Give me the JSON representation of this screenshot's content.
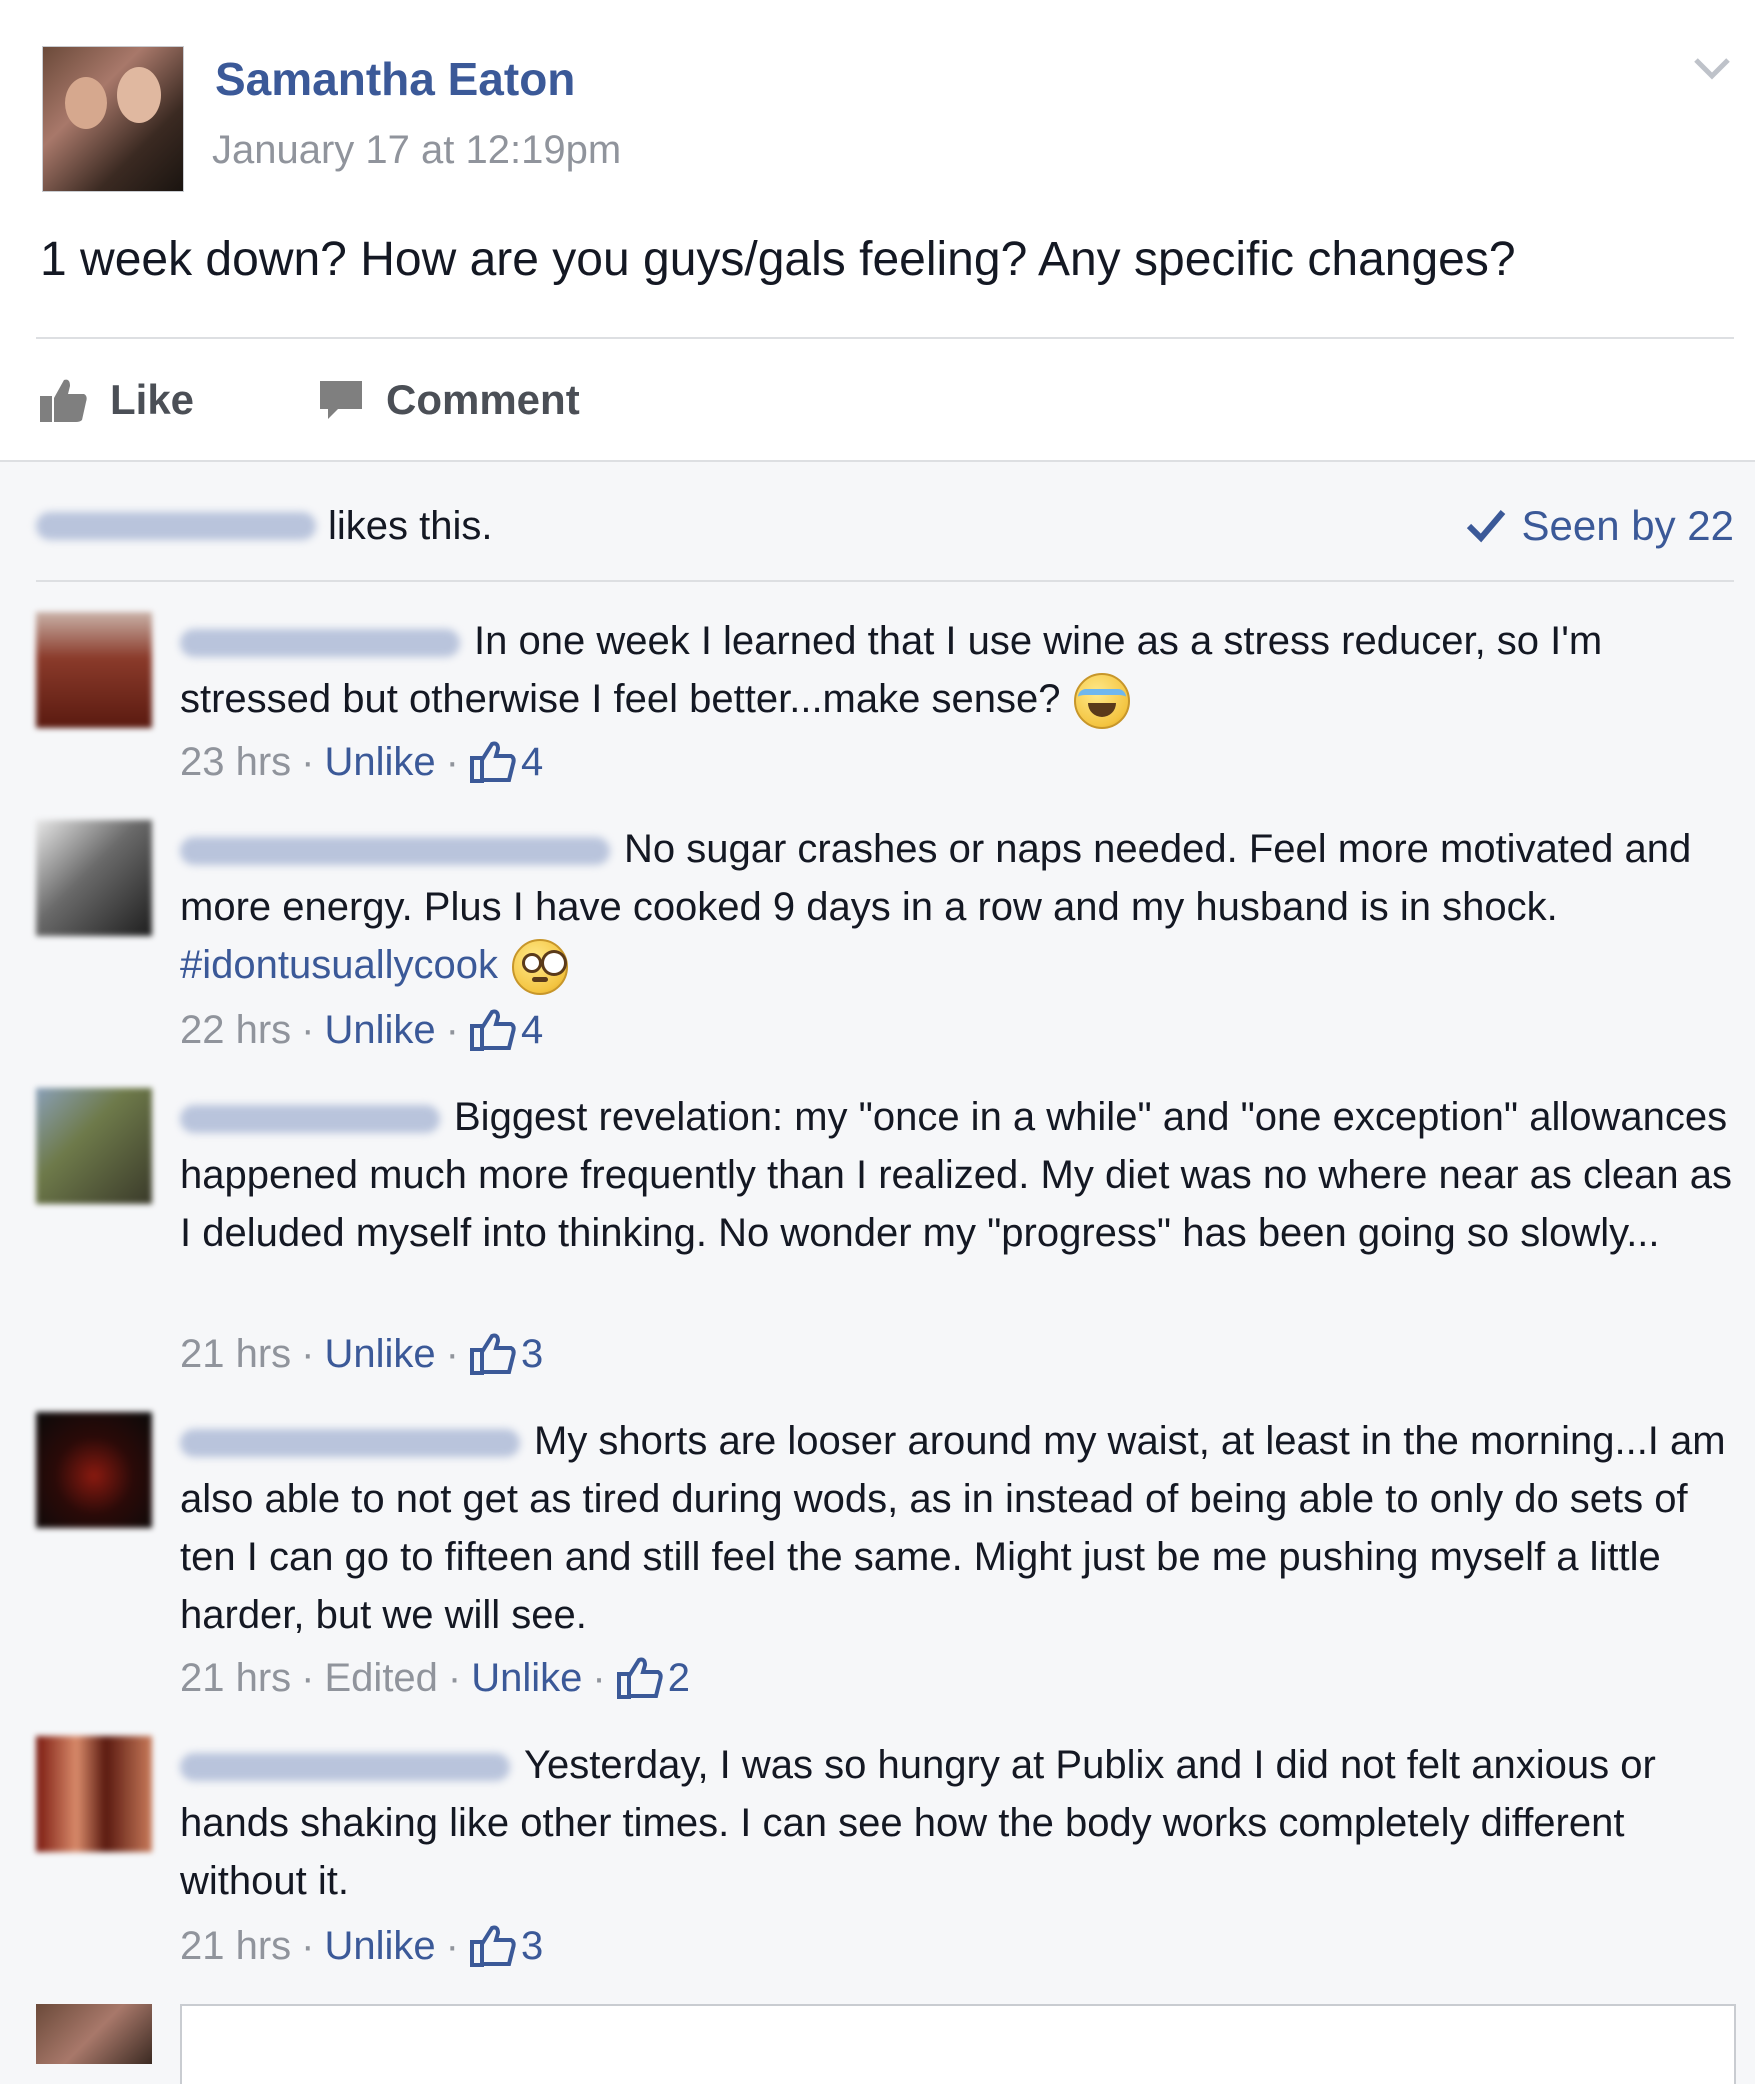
{
  "post": {
    "author": "Samantha Eaton",
    "timestamp": "January 17 at 12:19pm",
    "text": "1 week down? How are you guys/gals feeling? Any specific changes?",
    "actions": {
      "like": "Like",
      "comment": "Comment"
    }
  },
  "likes_bar": {
    "likes_text": "likes this.",
    "seen_by": "Seen by 22"
  },
  "comments": [
    {
      "text": "In one week I learned that I use wine as a stress reducer, so I'm stressed but otherwise I feel better...make sense?",
      "emoji": "tears-of-joy-emoji",
      "time": "23 hrs",
      "unlike": "Unlike",
      "likes": "4"
    },
    {
      "text": "No sugar crashes or naps needed. Feel more motivated and more energy. Plus I have cooked 9 days in a row and my husband is in shock.",
      "hashtag": "#idontusuallycook",
      "emoji": "flushed-face-emoji",
      "time": "22 hrs",
      "unlike": "Unlike",
      "likes": "4"
    },
    {
      "text": "Biggest revelation: my \"once in a while\" and \"one exception\" allowances happened much more frequently than I realized. My diet was no where near as clean as I deluded myself into thinking. No wonder my \"progress\" has been going so slowly...",
      "time": "21 hrs",
      "unlike": "Unlike",
      "likes": "3"
    },
    {
      "text": "My shorts are looser around my waist, at least in the morning...I am also able to not get as tired during wods, as in instead of being able to only do sets of ten I can go to fifteen and still feel the same. Might just be me pushing myself a little harder, but we will see.",
      "time": "21 hrs",
      "edited": "Edited",
      "unlike": "Unlike",
      "likes": "2"
    },
    {
      "text": "Yesterday, I was so hungry at Publix and I did not felt anxious or hands shaking like other times. I can see how the body works completely different without it.",
      "time": "21 hrs",
      "unlike": "Unlike",
      "likes": "3"
    }
  ],
  "colors": {
    "link": "#3b5998",
    "meta": "#90949c",
    "text": "#141823",
    "background": "#f6f7f9"
  }
}
